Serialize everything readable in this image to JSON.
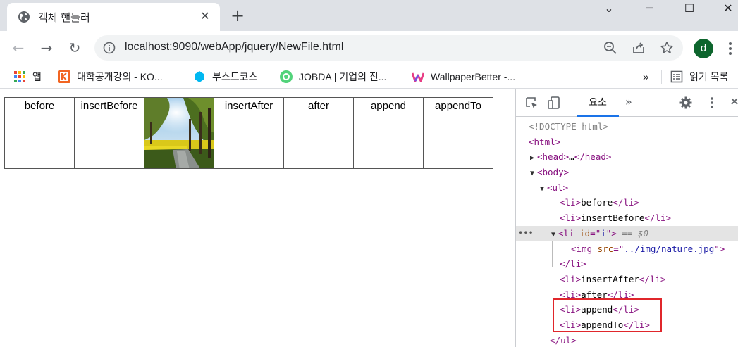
{
  "browser": {
    "tab_title": "객체 핸들러",
    "tab_close": "✕",
    "new_tab": "+",
    "window_controls": {
      "minimize": "─",
      "maximize": "☐",
      "close": "✕",
      "menu": "⌄"
    },
    "url": "localhost:9090/webApp/jquery/NewFile.html",
    "profile_initial": "d",
    "nav": {
      "back": "←",
      "forward": "→",
      "reload": "↻"
    }
  },
  "bookmarks": {
    "items": [
      {
        "label": "앱",
        "icon": "apps-grid-icon"
      },
      {
        "label": "대학공개강의 - KO...",
        "icon": "kocw-icon"
      },
      {
        "label": "부스트코스",
        "icon": "boostcourse-icon"
      },
      {
        "label": "JOBDA | 기업의 진...",
        "icon": "jobda-icon"
      },
      {
        "label": "WallpaperBetter -...",
        "icon": "wallpaperbetter-icon"
      }
    ],
    "overflow": "»",
    "reading_list": "읽기 목록"
  },
  "page": {
    "items": [
      "before",
      "insertBefore",
      "",
      "insertAfter",
      "after",
      "append",
      "appendTo"
    ],
    "image_alt": "nature"
  },
  "devtools": {
    "active_tab": "요소",
    "more_tabs": "»",
    "tree": {
      "doctype": "<!DOCTYPE html>",
      "html_open": "html",
      "head_text": "head",
      "head_ellipsis": "…",
      "body_open": "body",
      "ul_open": "ul",
      "li_before": "before",
      "li_insertBefore": "insertBefore",
      "li_id_attr": "id",
      "li_id_val": "i",
      "selected_suffix": "== $0",
      "img_src_attr": "src",
      "img_src_val": "../img/nature.jpg",
      "li_insertAfter": "insertAfter",
      "li_after": "after",
      "li_append": "append",
      "li_appendTo": "appendTo",
      "ul_close": "ul"
    }
  },
  "colors": {
    "tab_strip": "#dee1e6",
    "omnibox": "#f1f3f4",
    "avatar": "#0d652d",
    "highlight_box": "#e0262b",
    "devtools_tab_underline": "#1a73e8"
  }
}
